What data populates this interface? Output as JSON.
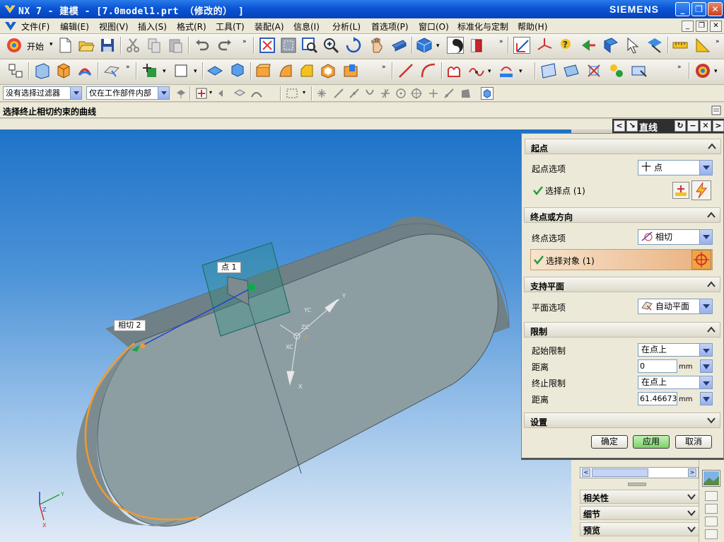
{
  "window": {
    "title": "NX 7 - 建模 - [7.0model1.prt （修改的） ]",
    "brand": "SIEMENS",
    "controls": {
      "minimize": "_",
      "restore": "❐",
      "close": "✕"
    }
  },
  "menubar": {
    "items": [
      "文件(F)",
      "编辑(E)",
      "视图(V)",
      "插入(S)",
      "格式(R)",
      "工具(T)",
      "装配(A)",
      "信息(I)",
      "分析(L)",
      "首选项(P)",
      "窗口(O)",
      "标准化与定制",
      "帮助(H)"
    ]
  },
  "toolbar": {
    "start_label": "开始",
    "overflow": "»"
  },
  "selection_bar": {
    "type_filter": "没有选择过滤器",
    "scope_filter": "仅在工作部件内部"
  },
  "cue_line": "选择终止相切约束的曲线",
  "dialog": {
    "title": "直线",
    "groups": {
      "start": {
        "title": "起点",
        "option_label": "起点选项",
        "option_value": "点",
        "option_glyph": "十",
        "select_label": "选择点 (1)"
      },
      "end": {
        "title": "终点或方向",
        "option_label": "终点选项",
        "option_value": "相切",
        "select_label": "选择对象 (1)"
      },
      "plane": {
        "title": "支持平面",
        "option_label": "平面选项",
        "option_value": "自动平面"
      },
      "limits": {
        "title": "限制",
        "start_limit_label": "起始限制",
        "start_limit_value": "在点上",
        "start_distance_label": "距离",
        "start_distance_value": "0",
        "end_limit_label": "终止限制",
        "end_limit_value": "在点上",
        "end_distance_label": "距离",
        "end_distance_value": "61.46673",
        "unit": "mm"
      },
      "settings": {
        "title": "设置"
      }
    },
    "buttons": {
      "ok": "确定",
      "apply": "应用",
      "cancel": "取消"
    }
  },
  "resource_panel": {
    "groups": [
      "相关性",
      "细节",
      "预览"
    ]
  },
  "viewport": {
    "labels": {
      "point": "点 1",
      "tangent": "相切 2"
    },
    "axis": {
      "x": "X",
      "y": "Y",
      "z": "Z",
      "xc": "XC",
      "yc": "YC",
      "zc": "ZC"
    }
  },
  "colors": {
    "title_bar": "#0a54d6",
    "viewport_top": "#1e73c8",
    "viewport_bottom": "#dfeaf6",
    "part_face": "#8d9ea3",
    "part_side": "#6f8086",
    "highlight_edge": "#f49a2a",
    "line_preview": "#1f3fd6",
    "select_row": "#e9b07d",
    "apply_button": "#7dd26a"
  }
}
